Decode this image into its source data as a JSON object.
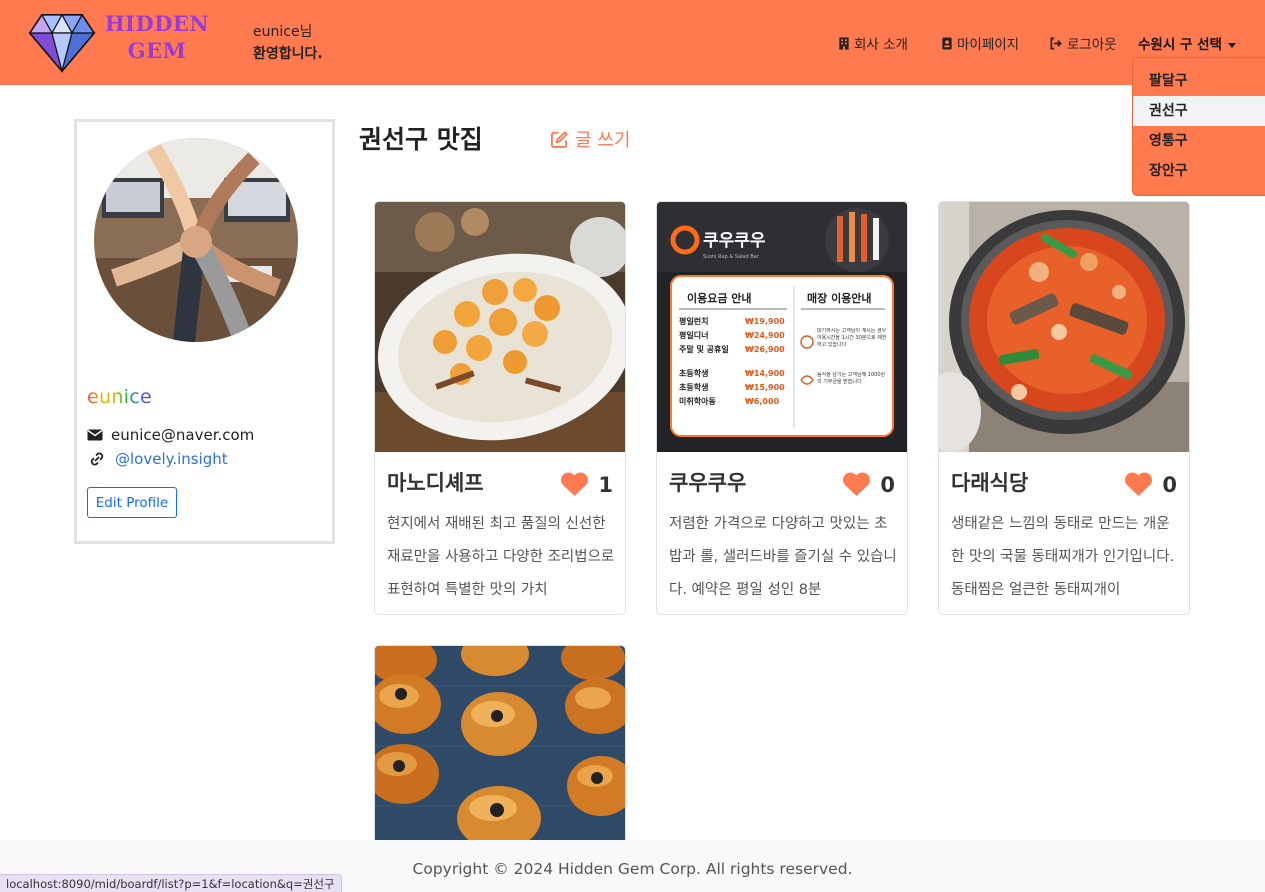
{
  "header": {
    "logo_text": "HIDDEN GEM",
    "logo_line1": "HIDDEN",
    "logo_line2": "GEM",
    "welcome_line1": "eunice님",
    "welcome_line2": "환영합니다.",
    "nav": {
      "company": "회사 소개",
      "mypage": "마이페이지",
      "logout": "로그아웃",
      "district_select": "수원시 구 선택"
    },
    "icons": {
      "company": "building-icon",
      "mypage": "id-badge-icon",
      "logout": "sign-out-icon"
    }
  },
  "dropdown": {
    "items": [
      {
        "label": "팔달구",
        "active": false
      },
      {
        "label": "권선구",
        "active": true
      },
      {
        "label": "영통구",
        "active": false
      },
      {
        "label": "장안구",
        "active": false
      }
    ]
  },
  "profile": {
    "username": "eunice",
    "email": "eunice@naver.com",
    "link": "@lovely.insight",
    "edit_button": "Edit Profile"
  },
  "main": {
    "title": "권선구 맛집",
    "write_label": "글 쓰기",
    "cards": [
      {
        "title": "마노디셰프",
        "likes": "1",
        "desc": "현지에서 재배된 최고 품질의 신선한 재료만을 사용하고 다양한 조리법으로 표현하여 특별한 맛의 가치"
      },
      {
        "title": "쿠우쿠우",
        "likes": "0",
        "desc": "저렴한 가격으로 다양하고 맛있는 초밥과 롤, 샐러드바를 즐기실 수 있습니다. 예약은 평일 성인 8분"
      },
      {
        "title": "다래식당",
        "likes": "0",
        "desc": "생태같은 느낌의 동태로 만드는 개운한 맛의 국물 동태찌개가 인기입니다. 동태찜은 얼큰한 동태찌개이"
      }
    ],
    "card4_image": "bread-buns-photo"
  },
  "menu_image": {
    "brand": "쿠우쿠우",
    "sub": "Sushi Rap & Salad Bar",
    "left_title": "이용요금 안내",
    "right_title": "매장 이용안내",
    "rows": [
      {
        "label": "평일런치",
        "price": "₩19,900"
      },
      {
        "label": "평일디너",
        "price": "₩24,900"
      },
      {
        "label": "주말 및 공휴일",
        "price": "₩26,900"
      },
      {
        "label": "초등학생",
        "price": "₩14,900"
      },
      {
        "label": "초등학생",
        "price": "₩15,900"
      },
      {
        "label": "미취학아동",
        "price": "₩6,000"
      }
    ],
    "info1": "대기하시는 고객님이 계시는 경우 이용시간을 1시간 30분으로 제한하고 있습니다",
    "info2": "음식을 남기는 고객님께 1000원의 기부금을 받습니다"
  },
  "footer": {
    "copyright": "Copyright © 2024 Hidden Gem Corp. All rights reserved."
  },
  "status_bar": {
    "url": "localhost:8090/mid/boardf/list?p=1&f=location&q=권선구"
  },
  "colors": {
    "brand_orange": "#ff7b4f",
    "logo_purple": "#9b3ad8",
    "heart": "#ff7b4f",
    "link_blue": "#2f72d6",
    "button_blue": "#0d6efd"
  }
}
